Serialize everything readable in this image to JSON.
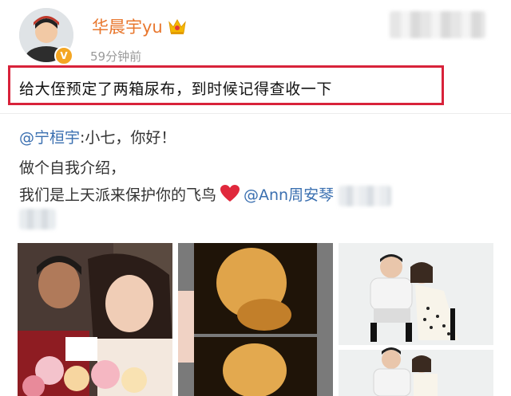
{
  "post": {
    "username": "华晨宇yu",
    "time": "59分钟前",
    "verified_badge": "V",
    "text": "给大侄预定了两箱尿布，到时候记得查收一下"
  },
  "repost": {
    "mention1": "@宁桓宇",
    "line1_rest": ":小七，你好！",
    "line2": "做个自我介绍，",
    "line3_text": "我们是上天派来保护你的飞鸟",
    "heart": "heart-emoji",
    "mention2": "@Ann周安琴"
  },
  "colors": {
    "username": "#e8772e",
    "mention": "#3a6fb0",
    "highlight_border": "#d8223a",
    "verified": "#f4a623"
  },
  "icons": [
    "crown-icon",
    "verified-icon",
    "heart-icon"
  ],
  "photos": [
    "couple-photo",
    "ultrasound-photo",
    "pregnancy-photo"
  ]
}
